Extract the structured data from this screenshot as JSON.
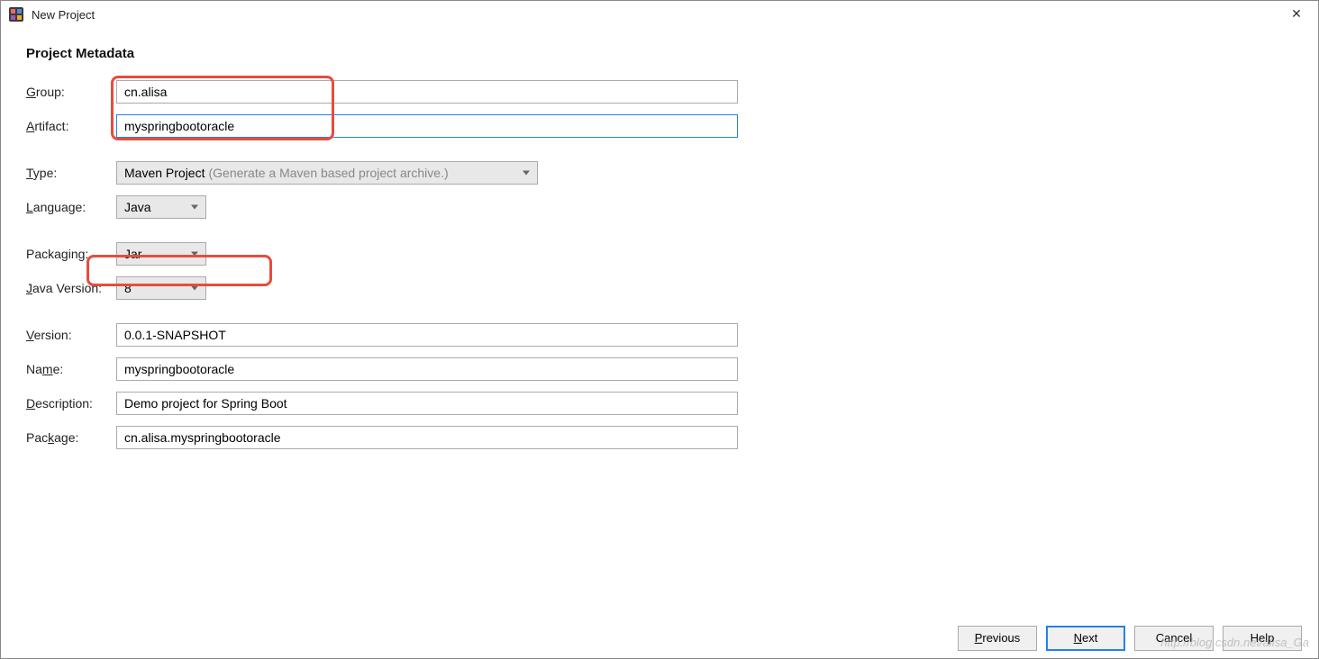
{
  "window": {
    "title": "New Project",
    "close_label": "✕"
  },
  "section_title": "Project Metadata",
  "labels": {
    "group": "Group:",
    "artifact": "Artifact:",
    "type": "Type:",
    "language": "Language:",
    "packaging": "Packaging:",
    "java_version": "Java Version:",
    "version": "Version:",
    "name": "Name:",
    "description": "Description:",
    "package": "Package:"
  },
  "mnemonics": {
    "group": "G",
    "artifact": "A",
    "type": "T",
    "language": "L",
    "packaging": "g",
    "java_version": "J",
    "version": "V",
    "name": "m",
    "description": "D",
    "package": "k"
  },
  "values": {
    "group": "cn.alisa",
    "artifact": "myspringbootoracle",
    "type": "Maven Project",
    "type_hint": "(Generate a Maven based project archive.)",
    "language": "Java",
    "packaging": "Jar",
    "java_version": "8",
    "version": "0.0.1-SNAPSHOT",
    "name": "myspringbootoracle",
    "description": "Demo project for Spring Boot",
    "package": "cn.alisa.myspringbootoracle"
  },
  "buttons": {
    "previous": "Previous",
    "next": "Next",
    "cancel": "Cancel",
    "help": "Help"
  },
  "watermark": "http://blog.csdn.net/alisa_Ga"
}
